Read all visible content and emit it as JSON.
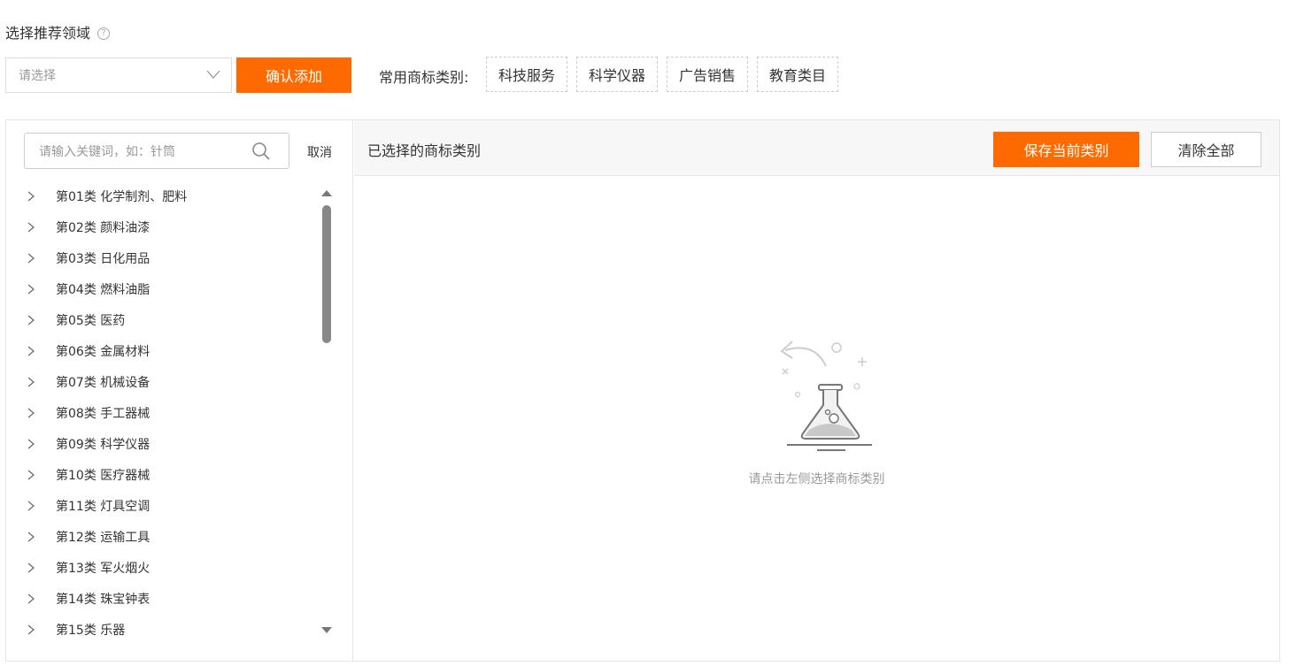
{
  "header": {
    "title": "选择推荐领域",
    "help_icon": "?"
  },
  "select": {
    "placeholder": "请选择"
  },
  "confirm_label": "确认添加",
  "common": {
    "label": "常用商标类别:",
    "chips": [
      "科技服务",
      "科学仪器",
      "广告销售",
      "教育类目"
    ]
  },
  "search": {
    "placeholder": "请输入关键词，如：针筒",
    "cancel_label": "取消"
  },
  "classes": [
    "第01类 化学制剂、肥料",
    "第02类 颜料油漆",
    "第03类 日化用品",
    "第04类 燃料油脂",
    "第05类 医药",
    "第06类 金属材料",
    "第07类 机械设备",
    "第08类 手工器械",
    "第09类 科学仪器",
    "第10类 医疗器械",
    "第11类 灯具空调",
    "第12类 运输工具",
    "第13类 军火烟火",
    "第14类 珠宝钟表",
    "第15类 乐器"
  ],
  "selected": {
    "title": "已选择的商标类别",
    "save_label": "保存当前类别",
    "clear_label": "清除全部",
    "empty_text": "请点击左侧选择商标类别"
  },
  "colors": {
    "accent": "#ff6a00",
    "border": "#e6e6e6",
    "muted": "#999999"
  }
}
